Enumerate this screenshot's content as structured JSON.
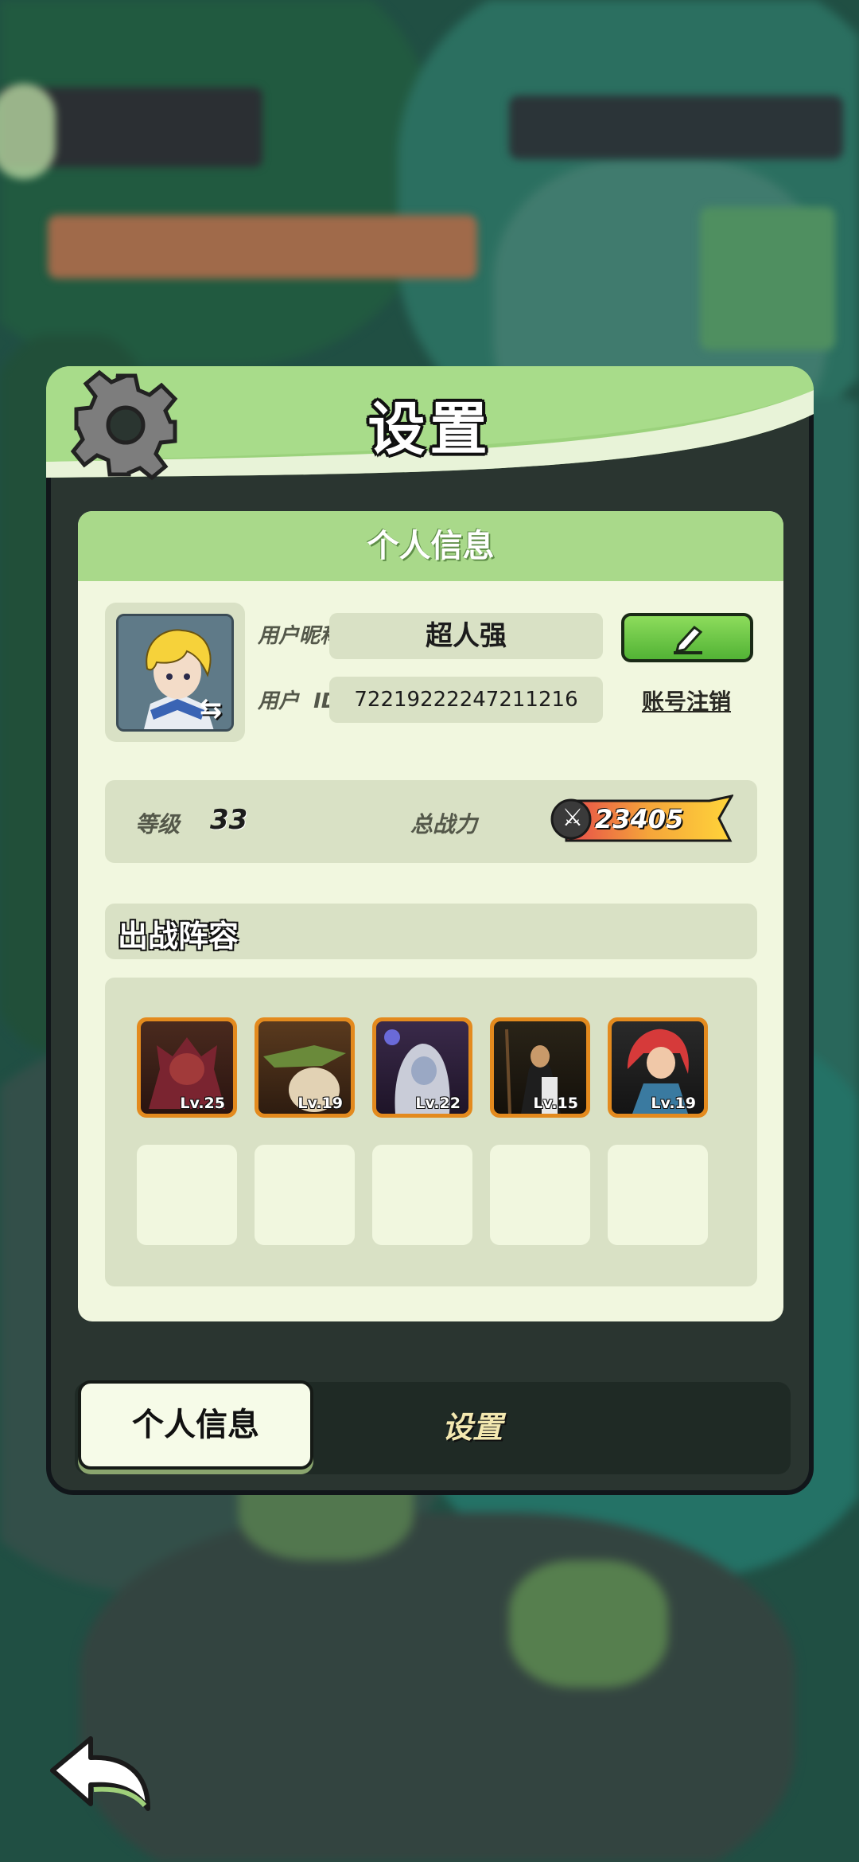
{
  "modal": {
    "title": "设置"
  },
  "profile": {
    "section_title": "个人信息",
    "nickname_label": "用户昵称",
    "nickname_value": "超人强",
    "id_label": "用户  ID",
    "id_value": "72219222247211216",
    "cancel_account": "账号注销",
    "level_label": "等级",
    "level_value": "33",
    "power_label": "总战力",
    "power_value": "23405"
  },
  "lineup": {
    "title": "出战阵容",
    "heroes": [
      {
        "level": "Lv.25"
      },
      {
        "level": "Lv.19"
      },
      {
        "level": "Lv.22"
      },
      {
        "level": "Lv.15"
      },
      {
        "level": "Lv.19"
      }
    ]
  },
  "tabs": {
    "info": "个人信息",
    "settings": "设置"
  },
  "icons": {
    "gear": "gear-icon",
    "edit": "pencil-icon",
    "swap": "swap-icon",
    "swords": "crossed-swords-icon",
    "back": "back-arrow-icon"
  }
}
